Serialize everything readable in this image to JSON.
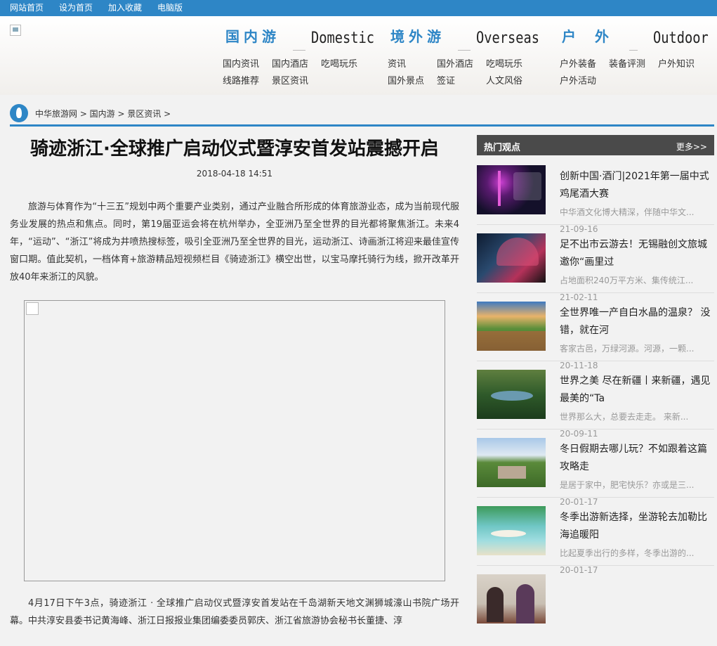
{
  "topbar": {
    "links": [
      "网站首页",
      "设为首页",
      "加入收藏",
      "电脑版"
    ]
  },
  "nav": {
    "domestic": {
      "cn": "国内游",
      "en": "Domestic",
      "links": [
        "国内资讯",
        "国内酒店",
        "吃喝玩乐",
        "线路推荐",
        "景区资讯"
      ]
    },
    "overseas": {
      "cn": "境外游",
      "en": "Overseas",
      "links": [
        "资讯",
        "国外酒店",
        "吃喝玩乐",
        "国外景点",
        "签证",
        "人文风俗"
      ]
    },
    "outdoor": {
      "cn": "户 外",
      "en": "Outdoor",
      "links": [
        "户外装备",
        "装备评测",
        "户外知识",
        "户外活动"
      ]
    }
  },
  "breadcrumb": "中华旅游网 > 国内游 > 景区资讯 >",
  "article": {
    "title": "骑迹浙江·全球推广启动仪式暨淳安首发站震撼开启",
    "date": "2018-04-18 14:51",
    "p1": "旅游与体育作为“十三五”规划中两个重要产业类别，通过产业融合所形成的体育旅游业态，成为当前现代服务业发展的热点和焦点。同时，第19届亚运会将在杭州举办，全亚洲乃至全世界的目光都将聚焦浙江。未来4年，“运动”、“浙江”将成为井喷热搜标签，吸引全亚洲乃至全世界的目光，运动浙江、诗画浙江将迎来最佳宣传窗口期。值此契机，一档体育+旅游精品短视频栏目《骑迹浙江》横空出世，以宝马摩托骑行为线，掀开改革开放40年来浙江的风貌。",
    "p2": "4月17日下午3点，骑迹浙江 · 全球推广启动仪式暨淳安首发站在千岛湖新天地文渊狮城濠山书院广场开幕。中共淳安县委书记黄海峰、浙江日报报业集团编委委员郭庆、浙江省旅游协会秘书长董捷、淳"
  },
  "sidebar": {
    "title": "热门观点",
    "more": "更多>>",
    "items": [
      {
        "title": "创新中国·酒门|2021年第一届中式鸡尾酒大赛",
        "desc": "中华酒文化博大精深，伴随中华文...",
        "date": "21-09-16"
      },
      {
        "title": "足不出市云游去！无锡融创文旅城邀你“画里过",
        "desc": "占地面积240万平方米、集传统江...",
        "date": "21-02-11"
      },
      {
        "title": "全世界唯一产自白水晶的温泉？ 没错，就在河",
        "desc": "客家古邑，万绿河源。河源，一颗...",
        "date": "20-11-18"
      },
      {
        "title": "世界之美 尽在新疆丨来新疆，遇见最美的“Ta",
        "desc": "世界那么大，总要去走走。 来新...",
        "date": "20-09-11"
      },
      {
        "title": "冬日假期去哪儿玩？不如跟着这篇攻略走",
        "desc": "是居于家中，肥宅快乐？亦或是三...",
        "date": "20-01-17"
      },
      {
        "title": "冬季出游新选择，坐游轮去加勒比海追暖阳",
        "desc": "比起夏季出行的多样，冬季出游的...",
        "date": "20-01-17"
      }
    ]
  },
  "colors": {
    "brand": "#2e86c6",
    "sidebar_head": "#4a4a4a",
    "meta": "#999999"
  }
}
